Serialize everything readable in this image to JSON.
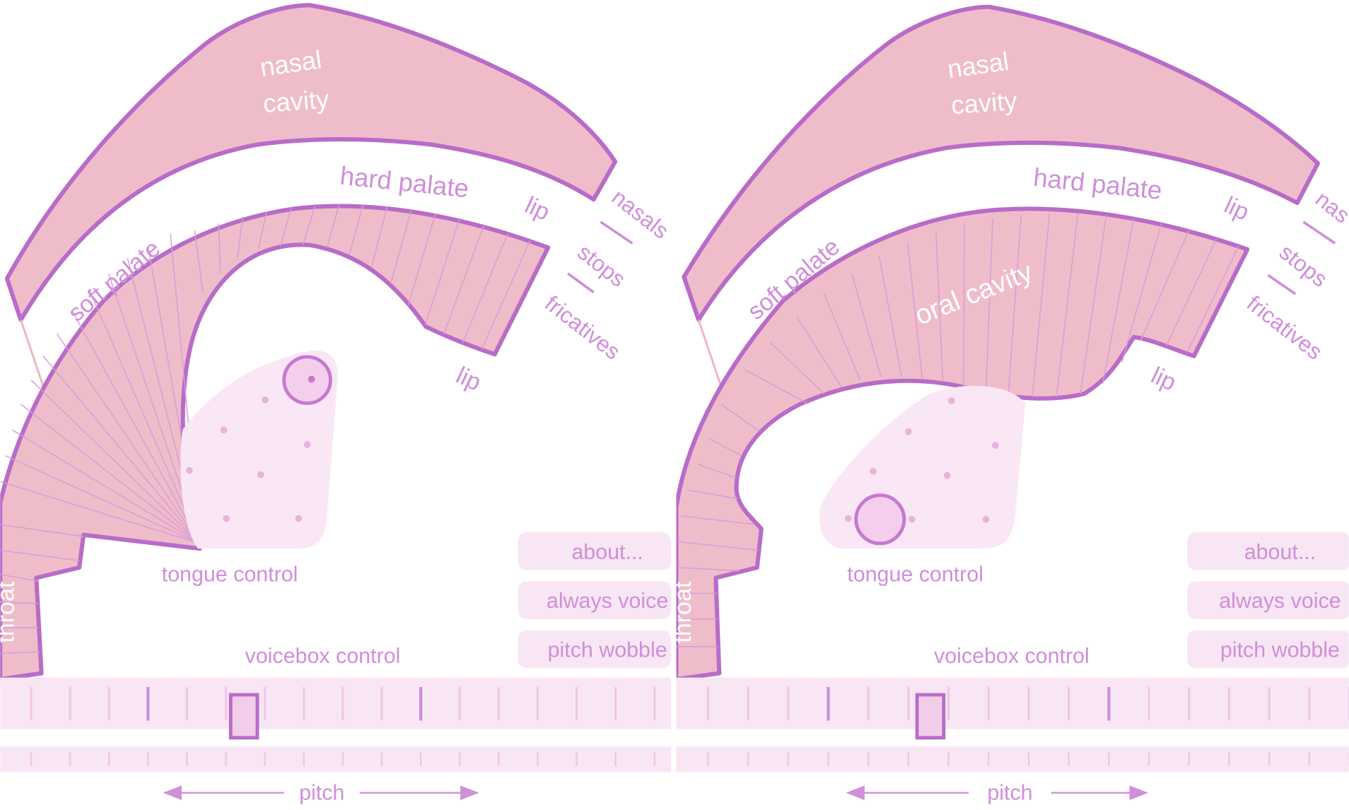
{
  "colors": {
    "outline": "#b86cc8",
    "fill": "#efbdca",
    "label": "#cf8fd9",
    "panel": "#f9e6f4",
    "shade": "#f8e4f3",
    "white": "#ffffff"
  },
  "panels": [
    {
      "labels": {
        "nasal": "nasal",
        "cavity": "cavity",
        "hard_palate": "hard palate",
        "soft_palate": "soft palate",
        "lip_top": "lip",
        "lip_bottom": "lip",
        "nasals": "nasals",
        "stops": "stops",
        "fricatives": "fricatives",
        "throat": "throat",
        "tongue_control": "tongue control",
        "voicebox_control": "voicebox control",
        "pitch": "pitch"
      },
      "buttons": {
        "about": "about...",
        "always_voice": "always voice",
        "pitch_wobble": "pitch wobble"
      }
    },
    {
      "labels": {
        "nasal": "nasal",
        "cavity": "cavity",
        "hard_palate": "hard palate",
        "soft_palate": "soft palate",
        "oral_cavity": "oral cavity",
        "lip_top": "lip",
        "lip_bottom": "lip",
        "nasals": "nas",
        "stops": "stops",
        "fricatives": "fricatives",
        "throat": "throat",
        "tongue_control": "tongue control",
        "voicebox_control": "voicebox control",
        "pitch": "pitch"
      },
      "buttons": {
        "about": "about...",
        "always_voice": "always voice",
        "pitch_wobble": "pitch wobble"
      }
    }
  ],
  "icons": [
    "tongue-handle-icon",
    "pitch-slider-handle-icon",
    "pitch-arrow-left-icon",
    "pitch-arrow-right-icon"
  ]
}
